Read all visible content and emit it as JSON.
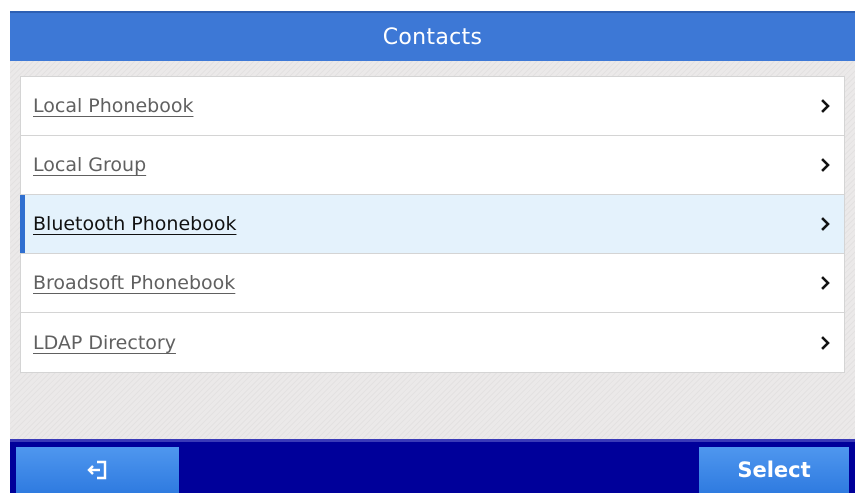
{
  "header": {
    "title": "Contacts"
  },
  "menu": {
    "items": [
      {
        "label": "Local Phonebook",
        "selected": false
      },
      {
        "label": "Local Group",
        "selected": false
      },
      {
        "label": "Bluetooth Phonebook",
        "selected": true
      },
      {
        "label": "Broadsoft Phonebook",
        "selected": false
      },
      {
        "label": "LDAP Directory",
        "selected": false
      }
    ]
  },
  "softkeys": {
    "left_icon": "exit-icon",
    "right_label": "Select"
  },
  "colors": {
    "title_bar": "#3d78d6",
    "bottom_bar": "#00009a",
    "softkey": "#3a86e8",
    "selected_row": "#e4f2fc",
    "selected_indicator": "#2f6fd0"
  }
}
